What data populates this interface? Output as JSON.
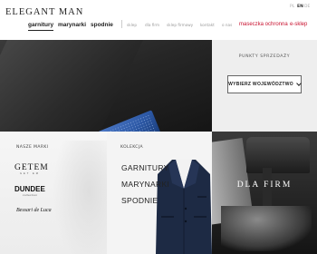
{
  "header": {
    "logo": "ELEGANT MAN",
    "languages": [
      "PL",
      "EN",
      "DE"
    ],
    "main_nav": [
      "garnitury",
      "marynarki",
      "spodnie"
    ],
    "sub_nav": [
      "sklep",
      "dla firm",
      "sklep firmowy",
      "kontakt",
      "o nas"
    ],
    "maseczka": "maseczka ochronna",
    "eshop": "e-sklep"
  },
  "stores": {
    "title": "PUNKTY SPRZEDAŻY",
    "select_label": "WYBIERZ WOJEWÓDZTWO"
  },
  "brands": {
    "label": "NASZE MARKI",
    "getem": "GETEM",
    "getem_sub": "GET EM",
    "dundee": "DUNDEE",
    "dundee_sub": "collection",
    "bessari": "Bessari de Luca"
  },
  "collection": {
    "label": "KOLEKCJA",
    "items": [
      "GARNITURY",
      "MARYNARKI",
      "SPODNIE"
    ]
  },
  "firm": {
    "title": "DLA FIRM"
  },
  "colors": {
    "accent_red": "#c8102e",
    "pocket_square_blue": "#2d59a6",
    "suit_navy": "#1d2a44"
  }
}
